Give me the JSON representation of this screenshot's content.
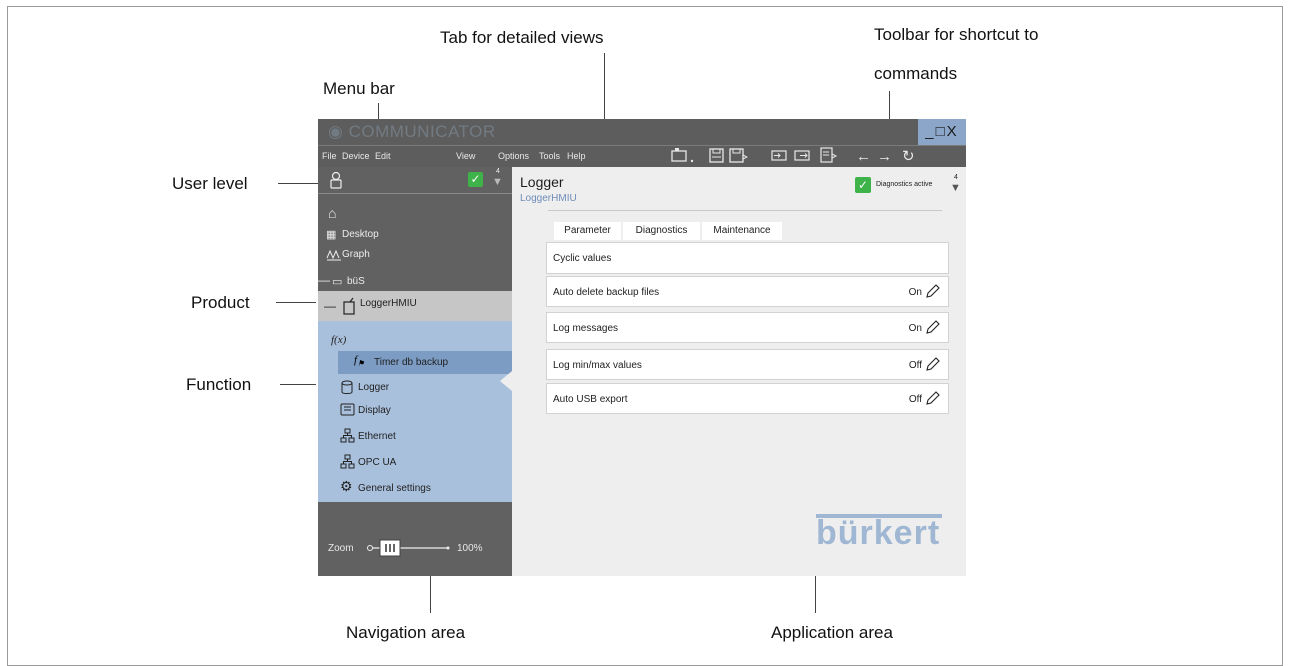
{
  "callouts": {
    "tab": "Tab for detailed views",
    "toolbar_line1": "Toolbar for shortcut to",
    "toolbar_line2": "commands",
    "menu_bar": "Menu bar",
    "user_level": "User level",
    "product": "Product",
    "function": "Function",
    "navigation": "Navigation area",
    "application": "Application area"
  },
  "app": {
    "title": "COMMUNICATOR",
    "window_controls": "_□X",
    "menu": [
      "File",
      "Device",
      "Edit",
      "View",
      "Options",
      "Tools",
      "Help"
    ],
    "toolbar_icons": [
      "device-icon",
      "save-icon",
      "save-as-icon",
      "import-icon",
      "export-icon",
      "report-icon",
      "back-arrow-icon",
      "forward-arrow-icon",
      "refresh-icon"
    ]
  },
  "nav": {
    "user_level_number": "4",
    "items": {
      "desktop": "Desktop",
      "graph": "Graph",
      "bus": "büS",
      "product": "LoggerHMIU",
      "function_fx": "f(x)",
      "timer": "Timer db backup",
      "logger": "Logger",
      "display": "Display",
      "ethernet": "Ethernet",
      "opcua": "OPC UA",
      "general": "General settings"
    },
    "zoom_label": "Zoom",
    "zoom_value": "100%"
  },
  "main": {
    "title": "Logger",
    "subtitle": "LoggerHMIU",
    "diagnostics": "Diagnostics active",
    "user_level_number": "4",
    "tabs": [
      "Parameter",
      "Diagnostics",
      "Maintenance"
    ],
    "section": "Cyclic values",
    "rows": [
      {
        "label": "Auto delete backup files",
        "value": "On"
      },
      {
        "label": "Log messages",
        "value": "On"
      },
      {
        "label": "Log min/max values",
        "value": "Off"
      },
      {
        "label": "Auto USB export",
        "value": "Off"
      }
    ],
    "logo": "bürkert"
  },
  "colors": {
    "titlebar": "#5d5d5d",
    "nav_dark": "#616161",
    "nav_product": "#c6c6c6",
    "nav_function": "#a9c0dc",
    "nav_highlight": "#7c9cc4",
    "logo": "#9fb7d3",
    "check": "#3eb34a"
  }
}
